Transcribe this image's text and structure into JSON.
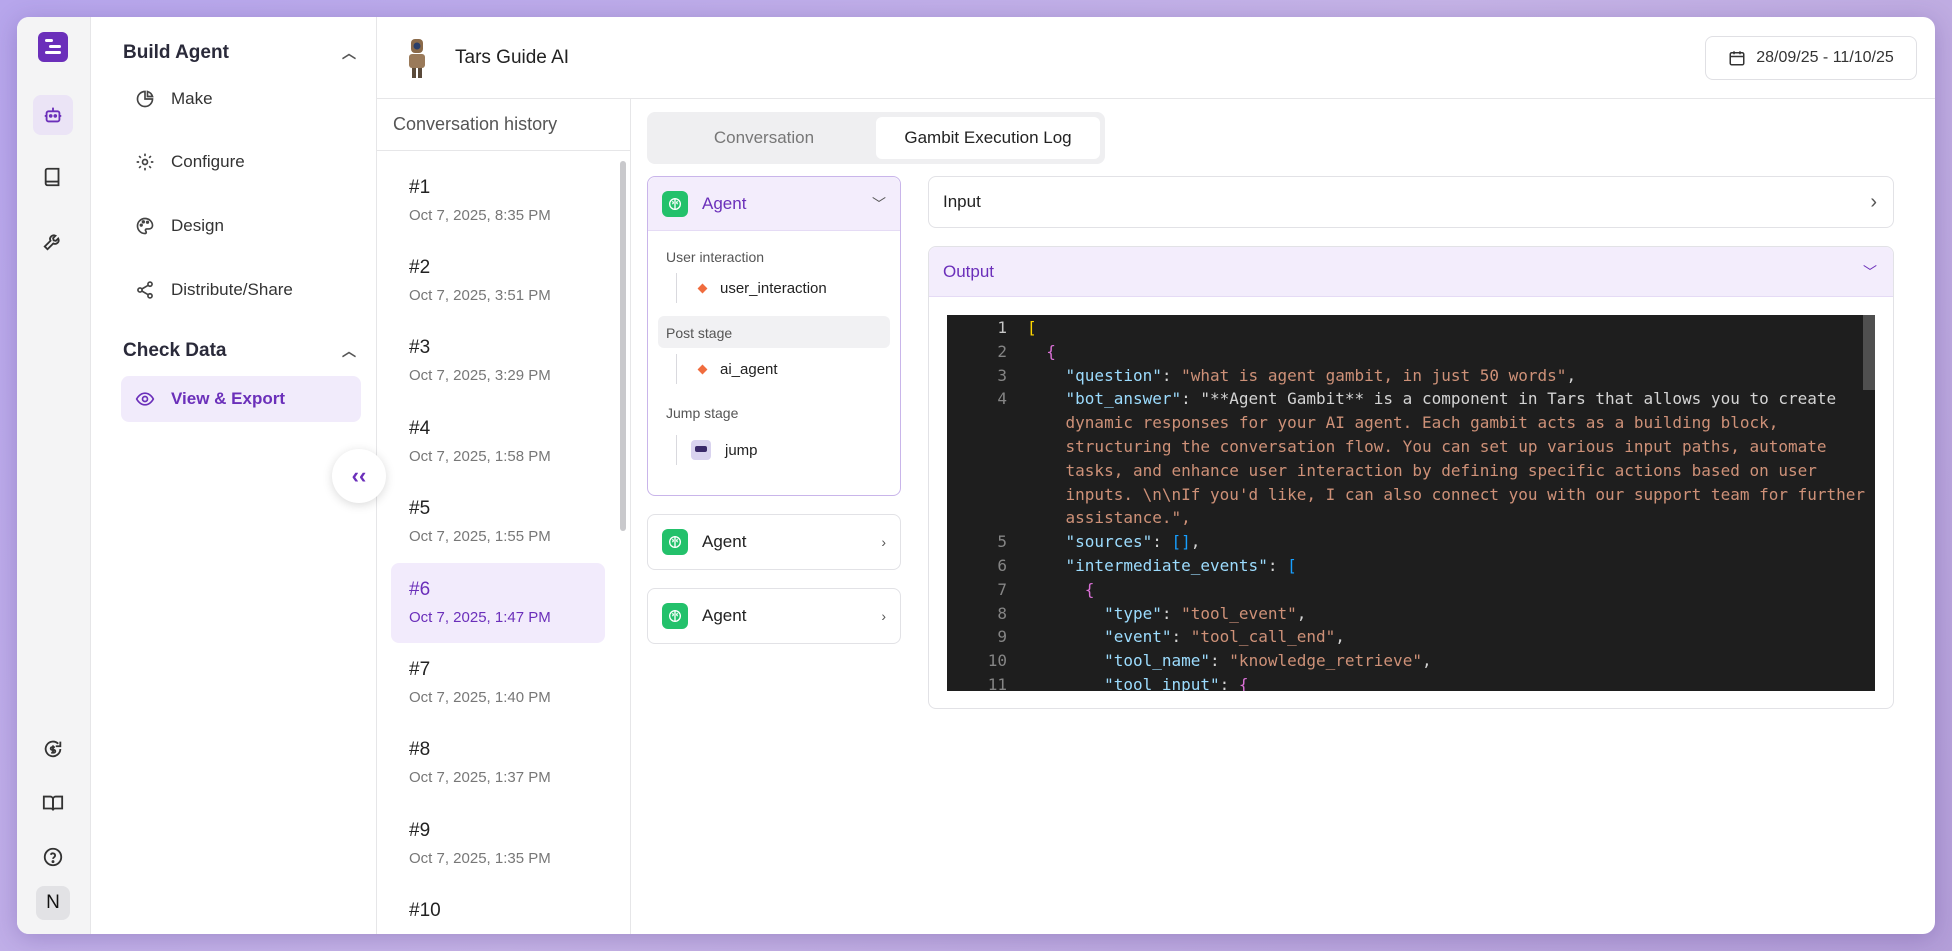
{
  "header": {
    "title": "Tars Guide AI",
    "date_range": "28/09/25 - 11/10/25"
  },
  "user_initial": "N",
  "nav": {
    "build_agent": {
      "title": "Build Agent",
      "items": [
        {
          "label": "Make",
          "icon": "pie-chart-icon"
        },
        {
          "label": "Configure",
          "icon": "gear-icon"
        },
        {
          "label": "Design",
          "icon": "palette-icon"
        },
        {
          "label": "Distribute/Share",
          "icon": "share-icon"
        }
      ]
    },
    "check_data": {
      "title": "Check Data",
      "items": [
        {
          "label": "View & Export",
          "icon": "eye-icon"
        }
      ]
    }
  },
  "history": {
    "title": "Conversation history",
    "items": [
      {
        "num": "#1",
        "time": "Oct 7, 2025, 8:35 PM"
      },
      {
        "num": "#2",
        "time": "Oct 7, 2025, 3:51 PM"
      },
      {
        "num": "#3",
        "time": "Oct 7, 2025, 3:29 PM"
      },
      {
        "num": "#4",
        "time": "Oct 7, 2025, 1:58 PM"
      },
      {
        "num": "#5",
        "time": "Oct 7, 2025, 1:55 PM"
      },
      {
        "num": "#6",
        "time": "Oct 7, 2025, 1:47 PM"
      },
      {
        "num": "#7",
        "time": "Oct 7, 2025, 1:40 PM"
      },
      {
        "num": "#8",
        "time": "Oct 7, 2025, 1:37 PM"
      },
      {
        "num": "#9",
        "time": "Oct 7, 2025, 1:35 PM"
      },
      {
        "num": "#10",
        "time": ""
      }
    ]
  },
  "tabs": [
    "Conversation",
    "Gambit Execution Log"
  ],
  "gambits": {
    "open": {
      "label": "Agent",
      "stages": [
        {
          "label": "User interaction",
          "item": "user_interaction"
        },
        {
          "label": "Post stage",
          "item": "ai_agent"
        },
        {
          "label": "Jump stage",
          "item": "jump"
        }
      ]
    },
    "others": [
      "Agent",
      "Agent"
    ]
  },
  "io": {
    "input_label": "Input",
    "output_label": "Output"
  },
  "code": {
    "line_numbers": [
      "1",
      "2",
      "3",
      "4",
      "",
      "",
      "",
      "",
      "",
      "5",
      "6",
      "7",
      "8",
      "9",
      "10",
      "11"
    ],
    "lines": [
      "[",
      "  {",
      "    \"question\": \"what is agent gambit, in just 50 words\",",
      "    \"bot_answer\": \"**Agent Gambit** is a component in Tars that allows you to create",
      "    dynamic responses for your AI agent. Each gambit acts as a building block,",
      "    structuring the conversation flow. You can set up various input paths, automate",
      "    tasks, and enhance user interaction by defining specific actions based on user",
      "    inputs. \\n\\nIf you'd like, I can also connect you with our support team for further",
      "    assistance.\",",
      "    \"sources\": [],",
      "    \"intermediate_events\": [",
      "      {",
      "        \"type\": \"tool_event\",",
      "        \"event\": \"tool_call_end\",",
      "        \"tool_name\": \"knowledge_retrieve\",",
      "        \"tool_input\": {"
    ]
  }
}
